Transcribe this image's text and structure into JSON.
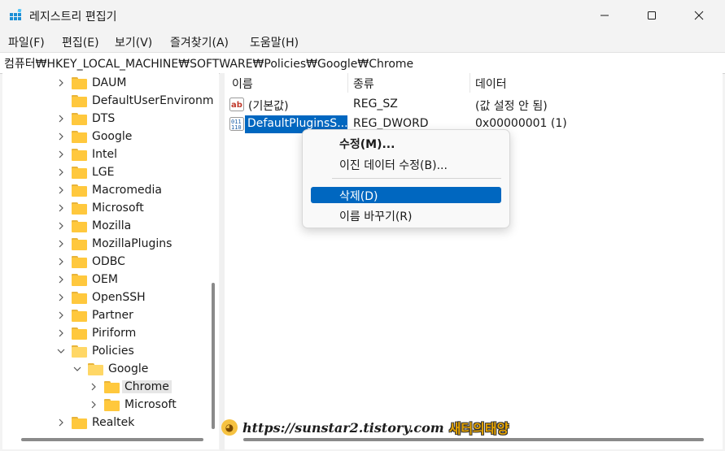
{
  "window": {
    "title": "레지스트리 편집기",
    "icon": "regedit-icon",
    "controls": [
      "minimize-icon",
      "maximize-icon",
      "close-icon"
    ]
  },
  "menu": {
    "items": [
      {
        "label": "파일(F)"
      },
      {
        "label": "편집(E)"
      },
      {
        "label": "보기(V)"
      },
      {
        "label": "즐겨찾기(A)"
      },
      {
        "label": "도움말(H)"
      }
    ]
  },
  "address": {
    "path": "컴퓨터₩HKEY_LOCAL_MACHINE₩SOFTWARE₩Policies₩Google₩Chrome"
  },
  "tree": {
    "items": [
      {
        "label": "DAUM",
        "expander": "collapsed"
      },
      {
        "label": "DefaultUserEnvironm",
        "expander": "none"
      },
      {
        "label": "DTS",
        "expander": "collapsed"
      },
      {
        "label": "Google",
        "expander": "collapsed"
      },
      {
        "label": "Intel",
        "expander": "collapsed"
      },
      {
        "label": "LGE",
        "expander": "collapsed"
      },
      {
        "label": "Macromedia",
        "expander": "collapsed"
      },
      {
        "label": "Microsoft",
        "expander": "collapsed"
      },
      {
        "label": "Mozilla",
        "expander": "collapsed"
      },
      {
        "label": "MozillaPlugins",
        "expander": "collapsed"
      },
      {
        "label": "ODBC",
        "expander": "collapsed"
      },
      {
        "label": "OEM",
        "expander": "collapsed"
      },
      {
        "label": "OpenSSH",
        "expander": "collapsed"
      },
      {
        "label": "Partner",
        "expander": "collapsed"
      },
      {
        "label": "Piriform",
        "expander": "collapsed"
      },
      {
        "label": "Policies",
        "expander": "expanded"
      },
      {
        "label": "Google",
        "expander": "expanded"
      },
      {
        "label": "Chrome",
        "expander": "collapsed",
        "selected": true
      },
      {
        "label": "Microsoft",
        "expander": "collapsed"
      },
      {
        "label": "Realtek",
        "expander": "collapsed"
      }
    ]
  },
  "list": {
    "columns": {
      "name": "이름",
      "type": "종류",
      "data": "데이터"
    },
    "rows": [
      {
        "icon": "string-value-icon",
        "name": "(기본값)",
        "type": "REG_SZ",
        "data": "(값 설정 안 됨)"
      },
      {
        "icon": "binary-value-icon",
        "name": "DefaultPluginsS...",
        "type": "REG_DWORD",
        "data": "0x00000001 (1)",
        "selected": true
      }
    ]
  },
  "context_menu": {
    "items": [
      {
        "label": "수정(M)...",
        "bold": true
      },
      {
        "label": "이진 데이터 수정(B)..."
      },
      {
        "label": "삭제(D)",
        "highlighted": true
      },
      {
        "label": "이름 바꾸기(R)"
      }
    ]
  },
  "watermark": {
    "url": "https://sunstar2.tistory.com",
    "name": "새터의태양"
  },
  "colors": {
    "selection": "#0067c0",
    "folder": "#ffc83d"
  }
}
